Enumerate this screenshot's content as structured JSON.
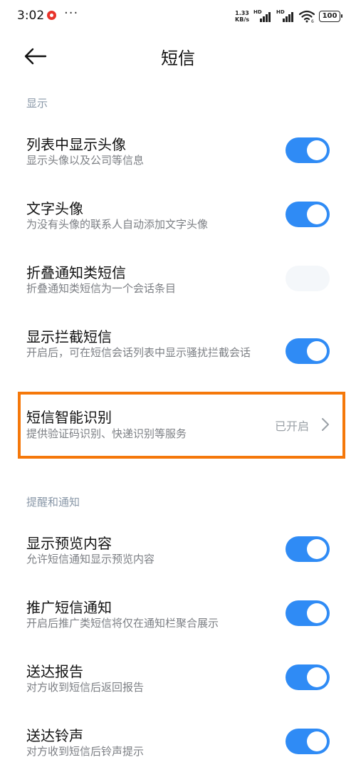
{
  "status_bar": {
    "time": "3:02",
    "dots": "···",
    "net_speed_value": "1.33",
    "net_speed_unit": "KB/s",
    "signal_label_1": "HD",
    "signal_label_2": "HD",
    "wifi_badge": "6",
    "battery": "100"
  },
  "nav": {
    "title": "短信",
    "back_icon": "arrow-left-icon"
  },
  "sections": [
    {
      "header": "显示"
    },
    {
      "header": "提醒和通知"
    }
  ],
  "rows": [
    {
      "title": "列表中显示头像",
      "desc": "显示头像以及公司等信息",
      "toggle_on": true
    },
    {
      "title": "文字头像",
      "desc": "为没有头像的联系人自动添加文字头像",
      "toggle_on": true
    },
    {
      "title": "折叠通知类短信",
      "desc": "折叠通知类短信为一个会话条目",
      "toggle_on": false
    },
    {
      "title": "显示拦截短信",
      "desc": "开启后，可在短信会话列表中显示骚扰拦截会话",
      "toggle_on": true
    },
    {
      "title": "短信智能识别",
      "desc": "提供验证码识别、快递识别等服务",
      "value": "已开启",
      "icon": "chevron-right-icon"
    },
    {
      "title": "显示预览内容",
      "desc": "允许短信通知显示预览内容",
      "toggle_on": true
    },
    {
      "title": "推广短信通知",
      "desc": "开启后推广类短信将仅在通知栏聚合展示",
      "toggle_on": true
    },
    {
      "title": "送达报告",
      "desc": "对方收到短信后返回报告",
      "toggle_on": true
    },
    {
      "title": "送达铃声",
      "desc": "对方收到短信后铃声提示",
      "toggle_on": true
    }
  ],
  "colors": {
    "accent": "#2f8bf5",
    "highlight": "#f5780a",
    "section_header": "#8a98a8",
    "secondary_text": "#7c7f84"
  }
}
